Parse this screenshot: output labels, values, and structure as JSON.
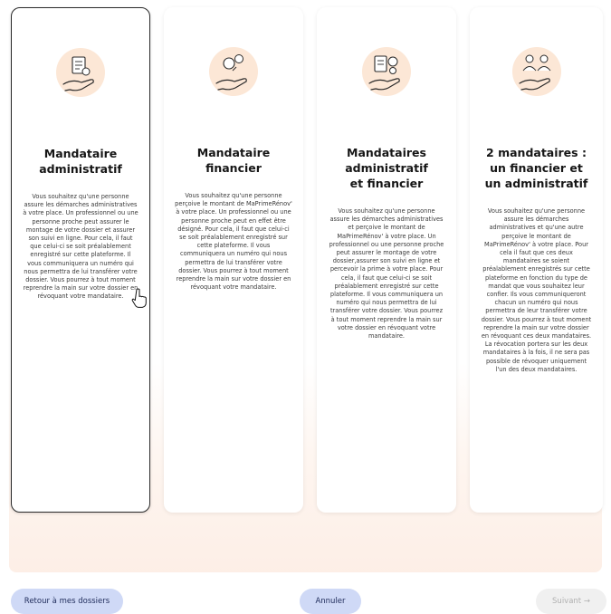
{
  "cards": [
    {
      "title": "Mandataire administratif",
      "icon": "documents-hand-icon",
      "selected": true,
      "text": "Vous souhaitez qu'une personne assure les démarches administratives à votre place. Un professionnel ou une personne proche peut assurer le montage de votre dossier et assurer son suivi en ligne. Pour cela, il faut que celui-ci se soit préalablement enregistré sur cette plateforme. Il vous communiquera un numéro qui nous permettra de lui transférer votre dossier. Vous pourrez à tout moment reprendre la main sur votre dossier en révoquant votre mandataire."
    },
    {
      "title": "Mandataire financier",
      "icon": "coin-hand-icon",
      "selected": false,
      "text": "Vous souhaitez qu'une personne perçoive le montant de MaPrimeRénov' à votre place. Un professionnel ou une personne proche peut en effet être désigné. Pour cela, il faut que celui-ci se soit préalablement enregistré sur cette plateforme. Il vous communiquera un numéro qui nous permettra de lui transférer votre dossier. Vous pourrez à tout moment reprendre la main sur votre dossier en révoquant votre mandataire."
    },
    {
      "title": "Mandataires administratif et financier",
      "icon": "documents-coin-hand-icon",
      "selected": false,
      "text": "Vous souhaitez qu'une personne assure les démarches administratives et perçoive le montant de MaPrimeRénov' à votre place. Un professionnel ou une personne proche peut assurer le montage de votre dossier,assurer son suivi en ligne et percevoir la prime à votre place. Pour cela, il faut que celui-ci se soit préalablement enregistré sur cette plateforme. Il vous communiquera un numéro qui nous permettra de lui transférer votre dossier. Vous pourrez à tout moment reprendre la main sur votre dossier en révoquant votre mandataire."
    },
    {
      "title": "2 mandataires : un financier et un administratif",
      "icon": "two-people-hand-icon",
      "selected": false,
      "text": "Vous souhaitez qu'une personne assure les démarches administratives et qu'une autre perçoive le montant de MaPrimeRénov' à votre place. Pour cela il faut que ces deux mandataires se soient préalablement enregistrés sur cette plateforme en fonction du type de mandat que vous souhaitez leur confier. Ils vous communiqueront chacun un numéro qui nous permettra de leur transférer votre dossier. Vous pourrez à tout moment reprendre la main sur votre dossier en révoquant ces deux mandataires. La révocation portera sur les deux mandataires à la fois, il ne sera pas possible de révoquer uniquement l'un des deux mandataires."
    }
  ],
  "footer": {
    "back_label": "Retour à mes dossiers",
    "cancel_label": "Annuler",
    "next_label": "Suivant →"
  },
  "colors": {
    "illustration_bg": "#fce7d6",
    "primary_button_bg": "#cfd9f6",
    "disabled_button_bg": "#f0f0f0",
    "selected_border": "#2b2b2b"
  }
}
